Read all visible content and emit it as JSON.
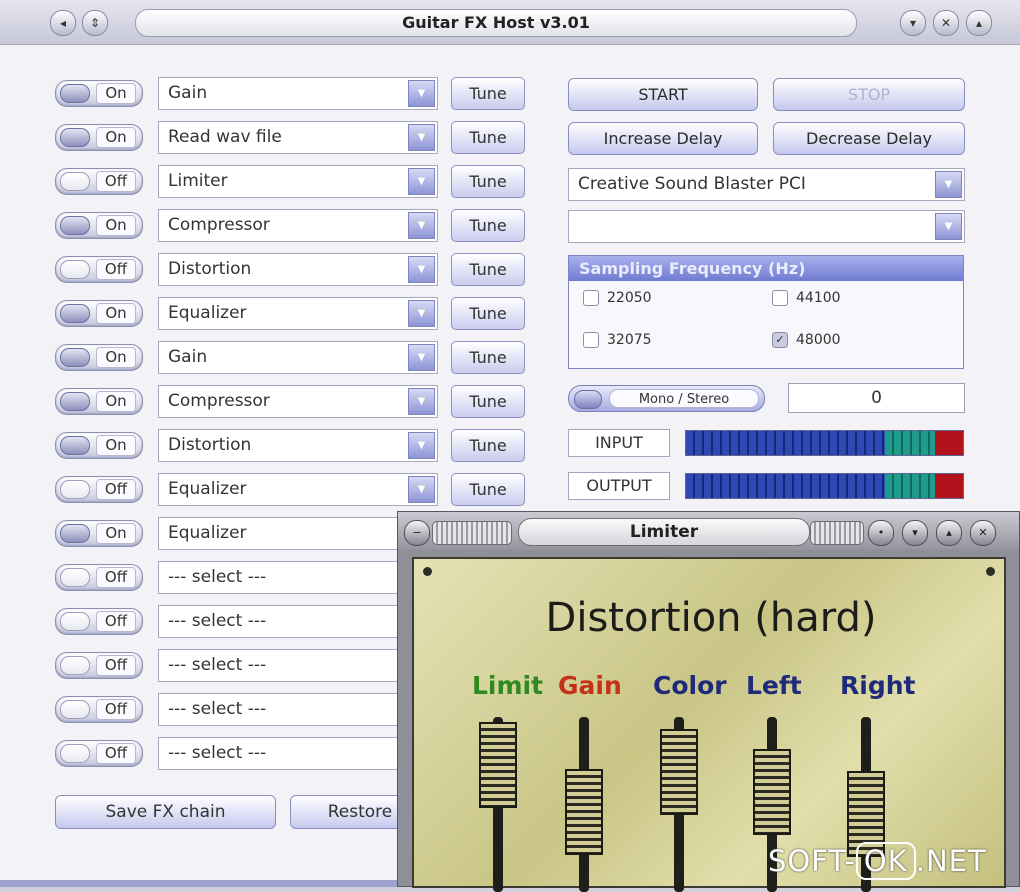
{
  "window": {
    "title": "Guitar FX Host v3.01"
  },
  "fx_slots": [
    {
      "state": "On",
      "effect": "Gain",
      "tune": "Tune"
    },
    {
      "state": "On",
      "effect": "Read wav file",
      "tune": "Tune"
    },
    {
      "state": "Off",
      "effect": "Limiter",
      "tune": "Tune"
    },
    {
      "state": "On",
      "effect": "Compressor",
      "tune": "Tune"
    },
    {
      "state": "Off",
      "effect": "Distortion",
      "tune": "Tune"
    },
    {
      "state": "On",
      "effect": "Equalizer",
      "tune": "Tune"
    },
    {
      "state": "On",
      "effect": "Gain",
      "tune": "Tune"
    },
    {
      "state": "On",
      "effect": "Compressor",
      "tune": "Tune"
    },
    {
      "state": "On",
      "effect": "Distortion",
      "tune": "Tune"
    },
    {
      "state": "Off",
      "effect": "Equalizer",
      "tune": "Tune"
    },
    {
      "state": "On",
      "effect": "Equalizer"
    },
    {
      "state": "Off",
      "effect": "--- select ---"
    },
    {
      "state": "Off",
      "effect": "--- select ---"
    },
    {
      "state": "Off",
      "effect": "--- select ---"
    },
    {
      "state": "Off",
      "effect": "--- select ---"
    },
    {
      "state": "Off",
      "effect": "--- select ---"
    }
  ],
  "controls": {
    "start": "START",
    "stop": "STOP",
    "increase_delay": "Increase Delay",
    "decrease_delay": "Decrease Delay",
    "device": "Creative Sound Blaster PCI",
    "device2": ""
  },
  "sampling": {
    "title": "Sampling Frequency (Hz)",
    "options": [
      {
        "label": "22050",
        "checked": false
      },
      {
        "label": "44100",
        "checked": false
      },
      {
        "label": "32075",
        "checked": false
      },
      {
        "label": "48000",
        "checked": true
      }
    ]
  },
  "mono_stereo": {
    "label": "Mono / Stereo",
    "value": "0"
  },
  "meters": {
    "input_label": "INPUT",
    "output_label": "OUTPUT",
    "input_level": 1.0,
    "output_level": 1.0
  },
  "footer": {
    "save": "Save FX chain",
    "restore": "Restore"
  },
  "limiter_window": {
    "title": "Limiter",
    "panel_title": "Distortion (hard)",
    "knobs": [
      {
        "label": "Limit",
        "color": "#2e8a1e"
      },
      {
        "label": "Gain",
        "color": "#c4321a"
      },
      {
        "label": "Color",
        "color": "#1f2a7a"
      },
      {
        "label": "Left",
        "color": "#1f2a7a"
      },
      {
        "label": "Right",
        "color": "#1f2a7a"
      }
    ]
  },
  "watermark": {
    "prefix": "SOFT-",
    "mid": "OK",
    "suffix": ".NET"
  }
}
